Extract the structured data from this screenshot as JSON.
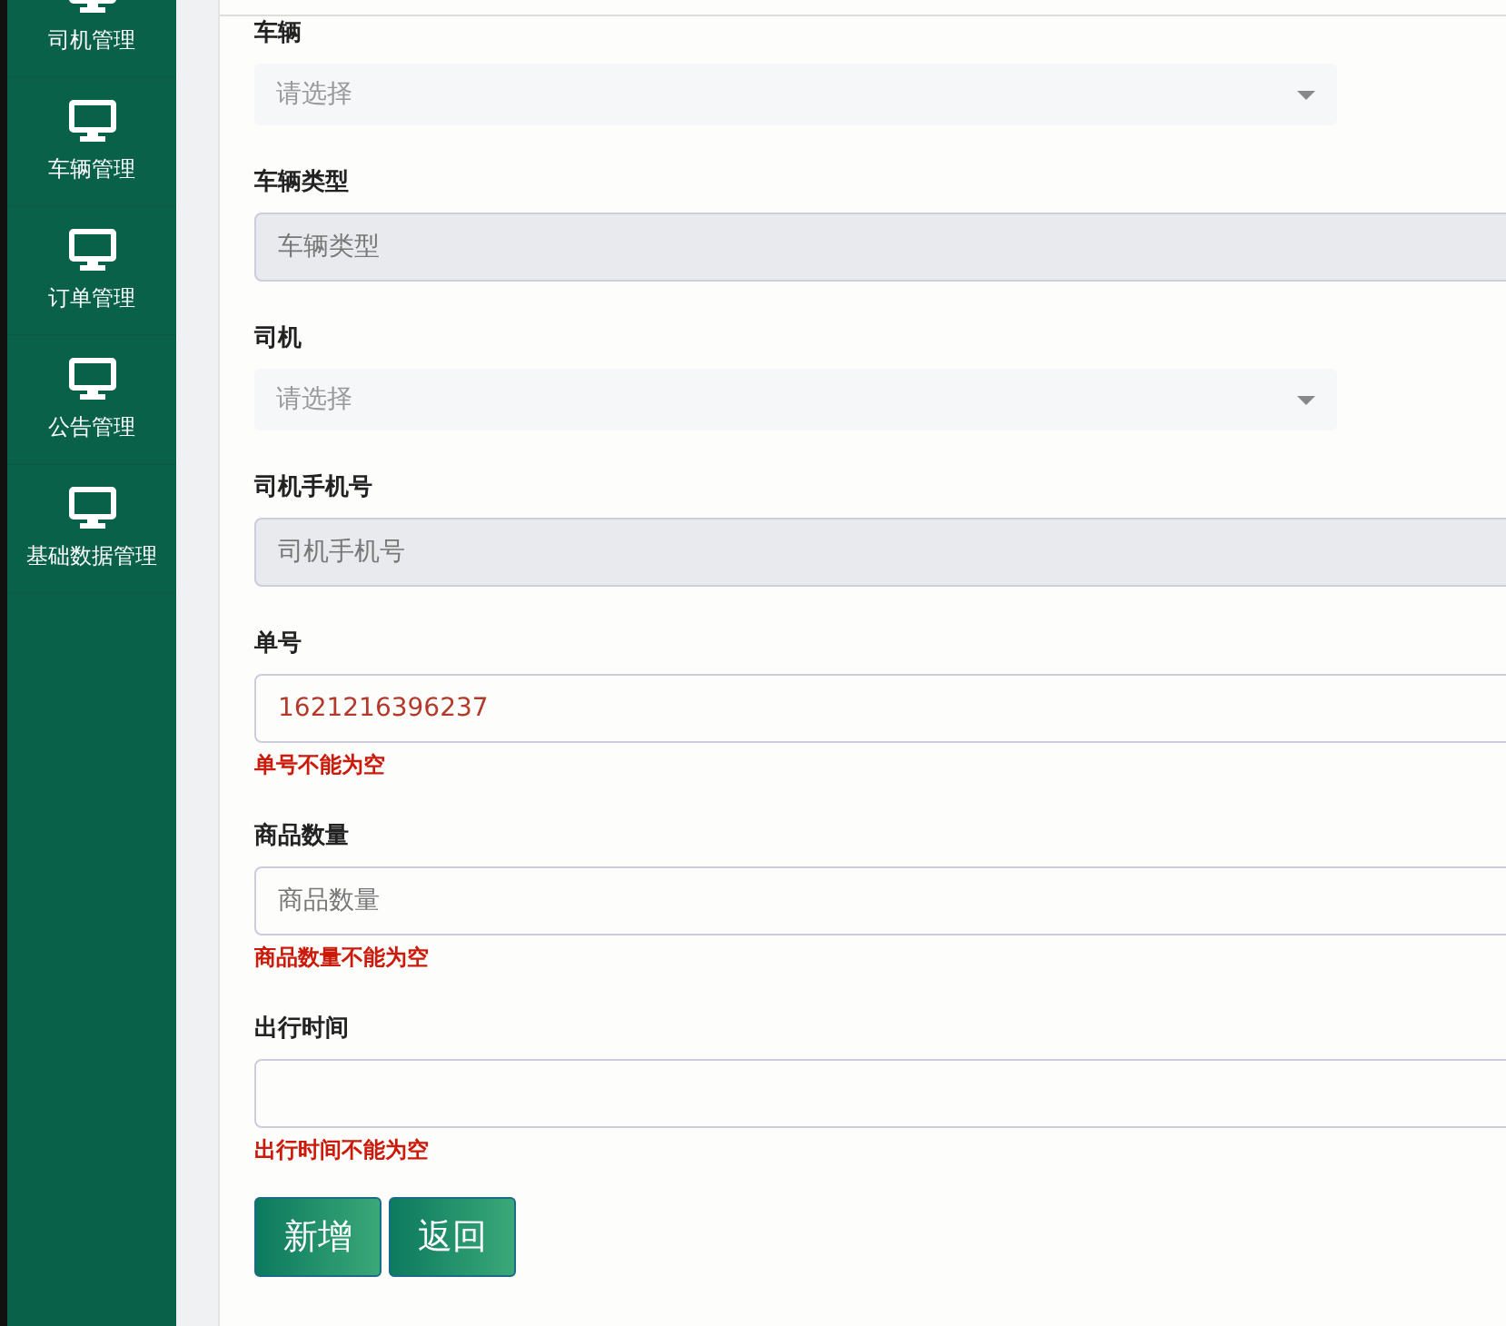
{
  "sidebar": {
    "items": [
      {
        "label": "司机管理"
      },
      {
        "label": "车辆管理"
      },
      {
        "label": "订单管理"
      },
      {
        "label": "公告管理"
      },
      {
        "label": "基础数据管理"
      }
    ]
  },
  "form": {
    "fields": [
      {
        "label": "车辆",
        "kind": "select",
        "placeholder": "请选择"
      },
      {
        "label": "车辆类型",
        "kind": "readonly",
        "placeholder": "车辆类型"
      },
      {
        "label": "司机",
        "kind": "select",
        "placeholder": "请选择"
      },
      {
        "label": "司机手机号",
        "kind": "readonly",
        "placeholder": "司机手机号"
      },
      {
        "label": "单号",
        "kind": "input",
        "value": "1621216396237",
        "error": "单号不能为空"
      },
      {
        "label": "商品数量",
        "kind": "input",
        "placeholder": "商品数量",
        "error": "商品数量不能为空"
      },
      {
        "label": "出行时间",
        "kind": "input",
        "error": "出行时间不能为空"
      }
    ],
    "buttons": [
      "新增",
      "返回"
    ]
  }
}
